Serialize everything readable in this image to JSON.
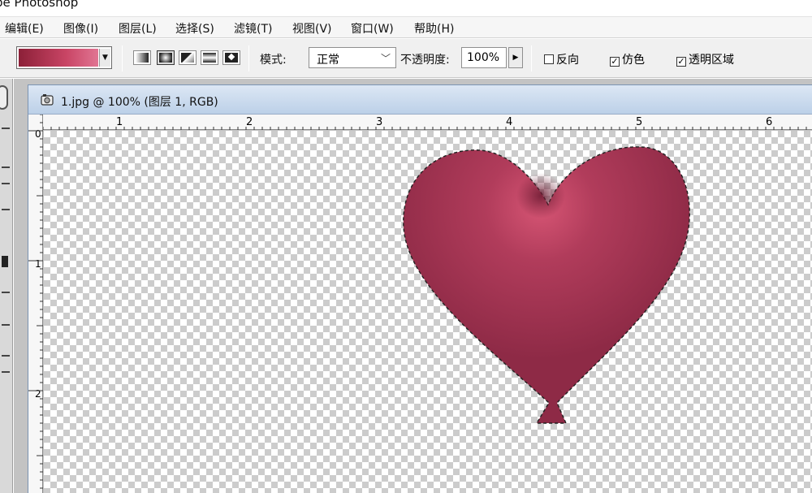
{
  "app": {
    "title_visible": "be Photoshop"
  },
  "menu": [
    {
      "label": "编辑(E)"
    },
    {
      "label": "图像(I)"
    },
    {
      "label": "图层(L)"
    },
    {
      "label": "选择(S)"
    },
    {
      "label": "滤镜(T)"
    },
    {
      "label": "视图(V)"
    },
    {
      "label": "窗口(W)"
    },
    {
      "label": "帮助(H)"
    }
  ],
  "options": {
    "gradient_colors": [
      "#8c2038",
      "#c94565",
      "#e17593"
    ],
    "gradient_types": [
      "linear-gradient-icon",
      "radial-gradient-icon",
      "angle-gradient-icon",
      "reflected-gradient-icon",
      "diamond-gradient-icon"
    ],
    "selected_gradient_type_index": 1,
    "mode_label": "模式:",
    "mode_value": "正常",
    "opacity_label": "不透明度:",
    "opacity_value": "100%",
    "reverse_label": "反向",
    "reverse_checked": false,
    "dither_label": "仿色",
    "dither_checked": true,
    "transparency_label": "透明区域",
    "transparency_checked": true
  },
  "document": {
    "title": "1.jpg @ 100% (图层 1, RGB)",
    "ruler_top_labels": [
      "1",
      "2",
      "3",
      "4",
      "5",
      "6"
    ],
    "ruler_left_labels": [
      "0",
      "1",
      "2"
    ],
    "shape": "heart-balloon",
    "shape_colors": {
      "base": "#b13c5b",
      "highlight": "#d65574",
      "shadow": "#8e2a46"
    }
  }
}
